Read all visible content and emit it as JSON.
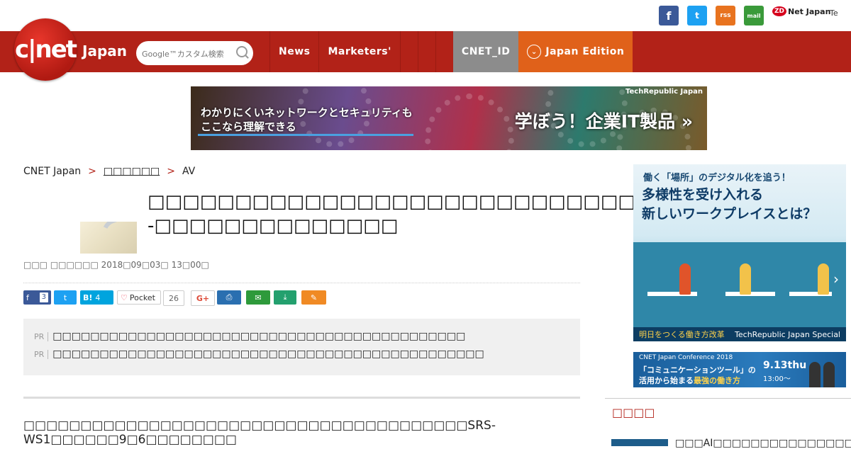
{
  "topbar": {
    "social": {
      "facebook": "f",
      "twitter": "t",
      "rss": "rss",
      "mail": "mail"
    },
    "zdnet_badge": "ZD",
    "zdnet_label": "Net Japan",
    "techrepublic_label": "Te"
  },
  "header": {
    "logo_text": "c|net",
    "logo_region": "Japan",
    "search_placeholder": "Google™カスタム検索",
    "nav": [
      {
        "label": "News"
      },
      {
        "label": "Marketers'"
      }
    ],
    "cnet_id_label": "CNET_ID",
    "edition_label": "Japan Edition"
  },
  "banner": {
    "brand": "TechRepublic Japan",
    "line1": "わかりにくいネットワークとセキュリティも",
    "line2": "ここなら理解できる",
    "cta": "学ぼう！企業IT製品 »"
  },
  "breadcrumb": {
    "items": [
      "CNET Japan",
      "□□□□□□",
      "AV"
    ],
    "separator": ">"
  },
  "article": {
    "title": "□□□□□□□□□□□□□□□□□□□□□□□□□□□□□□□□□□□□□--□□□□□□□□□□□□□□",
    "byline": "□□□ □□□□□□   2018□09□03□ 13□00□",
    "lead": "□□□□□□□□□□□□□□□□□□□□□□□□□□□□□□□□□□□□□□□SRS-WS1□□□□□□9□6□□□□□□□□"
  },
  "share": {
    "facebook_count": "3",
    "hatena_label": "B!",
    "hatena_count": "4",
    "pocket_label": "Pocket",
    "pocket_count": "26",
    "gplus_label": "G+"
  },
  "pr": {
    "tag": "PR",
    "items": [
      "□□□□□□□□□□□□□□□□□□□□□□□□□□□□□□□□□□□□□□□□□□□□",
      "□□□□□□□□□□□□□□□□□□□□□□□□□□□□□□□□□□□□□□□□□□□□□□"
    ]
  },
  "sidebar": {
    "ad1": {
      "line1": "働く「場所」のデジタル化を追う！",
      "line2": "多様性を受け入れる",
      "line3": "新しいワークプレイスとは？",
      "footer_left": "明日をつくる働き方改革",
      "footer_right": "TechRepublic Japan Special"
    },
    "ad2": {
      "event": "CNET Japan Conference 2018",
      "line1": "「コミュニケーションツール」の",
      "line2_prefix": "活用から始まる",
      "line2_highlight": "最強の働き方",
      "date": "9.13thu",
      "time": "13:00〜"
    },
    "heading": "□□□□",
    "first_item": "□□□AI□□□□□□□□□□□□□□□"
  }
}
